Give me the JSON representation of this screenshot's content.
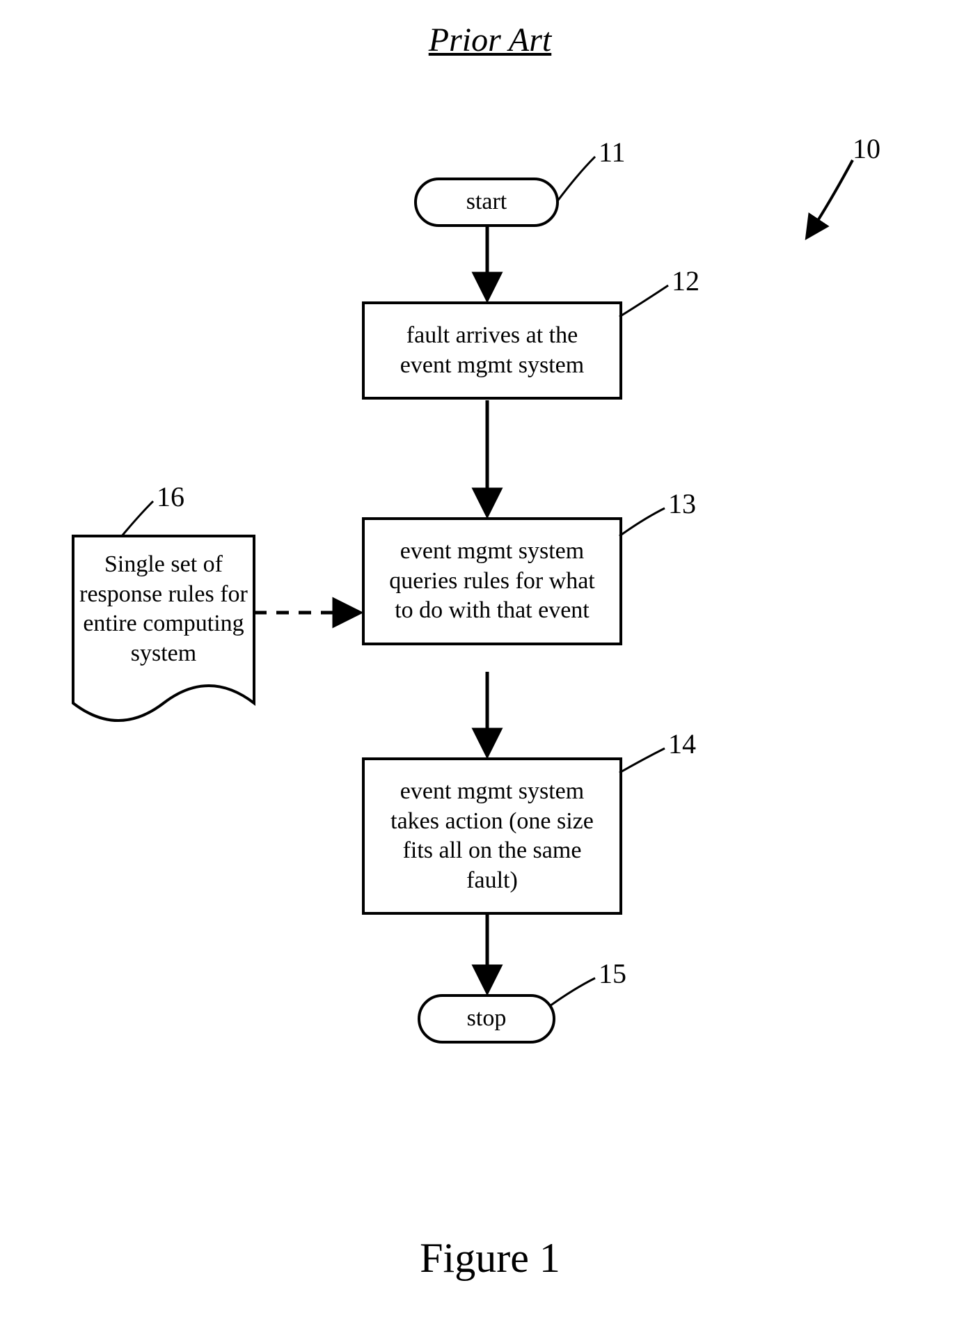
{
  "title": "Prior Art",
  "figure_caption": "Figure 1",
  "refs": {
    "overall": "10",
    "start": "11",
    "fault": "12",
    "query": "13",
    "action": "14",
    "stop": "15",
    "rules_doc": "16"
  },
  "nodes": {
    "start": "start",
    "fault": "fault arrives at the event mgmt system",
    "query": "event mgmt system queries rules for what to do with that event",
    "action": "event mgmt system takes action (one size fits all on the same fault)",
    "stop": "stop",
    "rules_doc": "Single set of response rules for entire computing system"
  },
  "chart_data": {
    "type": "flowchart",
    "title": "Prior Art",
    "nodes": [
      {
        "id": "11",
        "shape": "terminator",
        "label": "start"
      },
      {
        "id": "12",
        "shape": "process",
        "label": "fault arrives at the event mgmt system"
      },
      {
        "id": "13",
        "shape": "process",
        "label": "event mgmt system queries rules for what to do with that event"
      },
      {
        "id": "14",
        "shape": "process",
        "label": "event mgmt system takes action (one size fits all on the same fault)"
      },
      {
        "id": "15",
        "shape": "terminator",
        "label": "stop"
      },
      {
        "id": "16",
        "shape": "document",
        "label": "Single set of response rules for entire computing system"
      }
    ],
    "edges": [
      {
        "from": "11",
        "to": "12",
        "style": "solid"
      },
      {
        "from": "12",
        "to": "13",
        "style": "solid"
      },
      {
        "from": "16",
        "to": "13",
        "style": "dashed"
      },
      {
        "from": "13",
        "to": "14",
        "style": "solid"
      },
      {
        "from": "14",
        "to": "15",
        "style": "solid"
      }
    ],
    "overall_ref": "10"
  }
}
